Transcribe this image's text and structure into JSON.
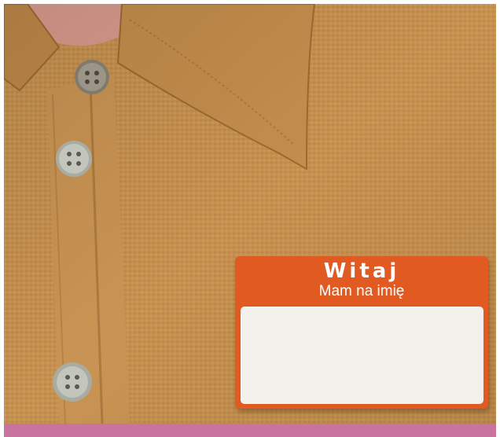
{
  "scene": {
    "subject": "shirt-with-name-tag",
    "colors": {
      "shirt": "#c6914f",
      "shirt_shadow": "#a8743a",
      "shirt_highlight": "#d7a566",
      "skin": "#d99a8c",
      "button": "#b9bcb3",
      "tag_orange": "#e05a22",
      "tag_white": "#f2f1ec",
      "bottom_band": "#c9739f"
    }
  },
  "name_tag": {
    "greeting": "Witaj",
    "subtitle": "Mam na imię",
    "name_value": ""
  }
}
